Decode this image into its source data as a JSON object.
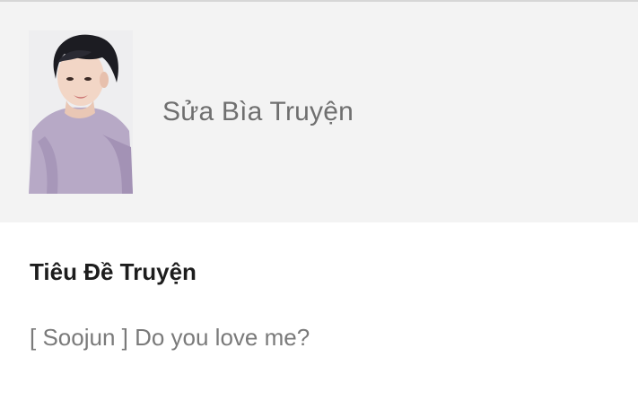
{
  "cover": {
    "edit_label": "Sửa Bìa Truyện",
    "image_description_icon": "cover-photo"
  },
  "story_title": {
    "heading": "Tiêu Đề Truyện",
    "value": "[ Soojun ] Do you love me?"
  },
  "colors": {
    "cover_background": "#f3f3f3",
    "page_background": "#ffffff",
    "heading_text": "#1d1d1d",
    "muted_text": "#6f6f6f"
  }
}
